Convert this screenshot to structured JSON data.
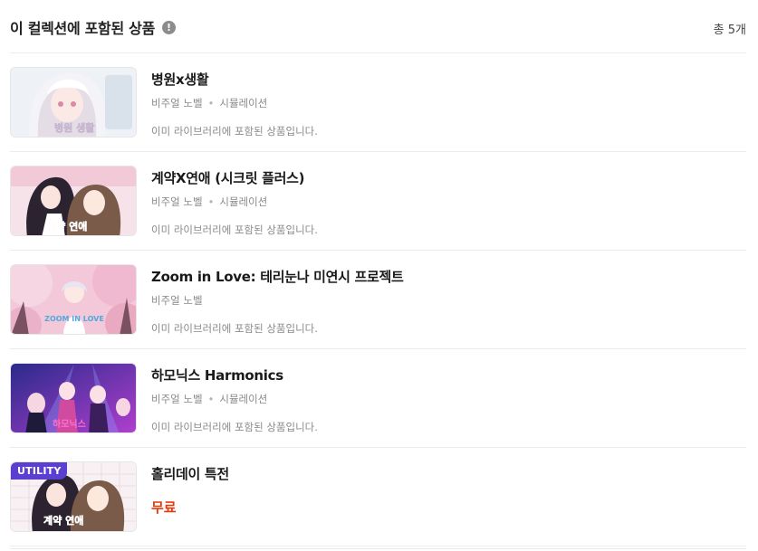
{
  "header": {
    "title": "이 컬렉션에 포함된 상품",
    "info_icon": "!",
    "count": "총 5개"
  },
  "items": [
    {
      "name": "병원x생활",
      "tags": [
        "비주얼 노벨",
        "시뮬레이션"
      ],
      "note": "이미 라이브러리에 포함된 상품입니다.",
      "thumb_title": "병원 생활"
    },
    {
      "name": "계약X연애 (시크릿 플러스)",
      "tags": [
        "비주얼 노벨",
        "시뮬레이션"
      ],
      "note": "이미 라이브러리에 포함된 상품입니다.",
      "thumb_title": "계약 연애"
    },
    {
      "name": "Zoom in Love: 테리눈나 미연시 프로젝트",
      "tags": [
        "비주얼 노벨"
      ],
      "note": "이미 라이브러리에 포함된 상품입니다.",
      "thumb_title": "ZOOM IN LOVE"
    },
    {
      "name": "하모닉스 Harmonics",
      "tags": [
        "비주얼 노벨",
        "시뮬레이션"
      ],
      "note": "이미 라이브러리에 포함된 상품입니다.",
      "thumb_title": "하모닉스"
    },
    {
      "name": "홀리데이 특전",
      "badge": "UTILITY",
      "price": "무료",
      "thumb_title": "계약 연애"
    }
  ],
  "colors": {
    "accent_price": "#e8380d",
    "badge_bg": "#5b3fd1",
    "muted_text": "#8a8a8a"
  }
}
